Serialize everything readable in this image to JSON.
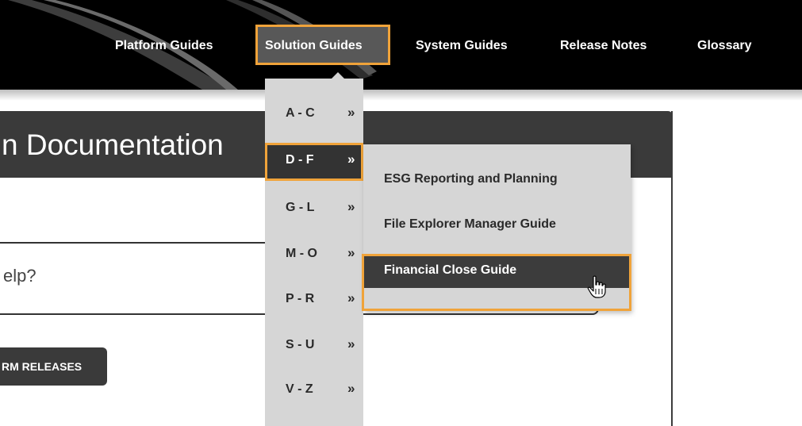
{
  "topnav": {
    "items": [
      {
        "label": "Platform Guides"
      },
      {
        "label": "Solution Guides"
      },
      {
        "label": "System Guides"
      },
      {
        "label": "Release Notes"
      },
      {
        "label": "Glossary"
      }
    ],
    "active_item": "Solution Guides"
  },
  "content": {
    "title_partial": "n Documentation",
    "search_placeholder_partial": "elp?",
    "release_button_partial": "RM RELEASES"
  },
  "dropdown": {
    "ranges": [
      {
        "label": "A - C",
        "arrow": "»"
      },
      {
        "label": "D - F",
        "arrow": "»"
      },
      {
        "label": "G - L",
        "arrow": "»"
      },
      {
        "label": "M - O",
        "arrow": "»"
      },
      {
        "label": "P - R",
        "arrow": "»"
      },
      {
        "label": "S - U",
        "arrow": "»"
      },
      {
        "label": "V - Z",
        "arrow": "»"
      }
    ],
    "active_range": "D - F"
  },
  "submenu": {
    "items": [
      {
        "label": "ESG Reporting and Planning"
      },
      {
        "label": "File Explorer Manager Guide"
      },
      {
        "label": "Financial Close Guide"
      }
    ],
    "active_item": "Financial Close Guide"
  },
  "colors": {
    "highlight": "#f0a33a",
    "nav_bg": "#000000",
    "menu_bg": "#d6d6d6",
    "active_bg": "#333333"
  },
  "icons": {
    "cursor": "hand-pointer-icon",
    "submenu_arrow": "double-chevron-right-icon"
  }
}
